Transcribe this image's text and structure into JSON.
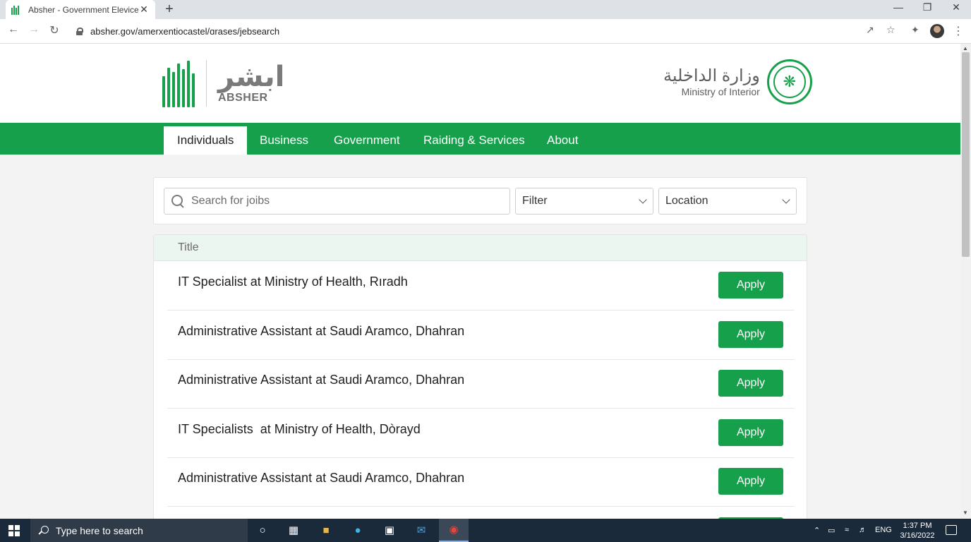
{
  "browser": {
    "tab_title": "Absher - Government Elevice",
    "tab_close": "✕",
    "new_tab": "+",
    "url": "absher.gov/amerxentiocastel/ɑrases/jebsearch",
    "window_min": "—",
    "window_max": "❐",
    "window_close": "✕"
  },
  "header": {
    "absher_arabic": "ابشر",
    "absher_english": "ABSHER",
    "moi_arabic": "وزارة الداخلية",
    "moi_english": "Ministry of Interior"
  },
  "nav": {
    "items": [
      {
        "label": "Individuals"
      },
      {
        "label": "Business"
      },
      {
        "label": "Government"
      },
      {
        "label": "Raiding & Services"
      },
      {
        "label": "About"
      }
    ]
  },
  "search": {
    "placeholder": "Search for joibs",
    "filter_label": "Filter",
    "location_label": "Location"
  },
  "results": {
    "column_title": "Title",
    "rows": [
      {
        "title": "IT Specialist at Ministry of Health, Rıradh",
        "action": "Apply"
      },
      {
        "title": "Administrative Assistant at Saudi Aramco, Dhahran",
        "action": "Apply"
      },
      {
        "title": "Administrative Assistant at Saudi Aramco, Dhahran",
        "action": "Apply"
      },
      {
        "title": "IT Specialists  at Ministry of Health, Dòrayd",
        "action": "Apply"
      },
      {
        "title": "Administrative Assistant at Saudi Aramco, Dhahran",
        "action": "Apply"
      }
    ]
  },
  "taskbar": {
    "search_placeholder": "Type here to search",
    "language": "ENG",
    "time": "1:37 PM",
    "date": "3/16/2022"
  },
  "colors": {
    "brand_green": "#17a04b",
    "taskbar": "#1b2a3a"
  }
}
